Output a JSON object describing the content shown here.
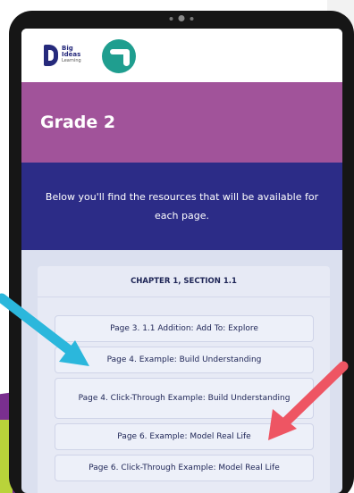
{
  "branding": {
    "logo_line1": "Big",
    "logo_line2": "Ideas",
    "logo_line3": "Learning"
  },
  "header": {
    "title": "Grade 2"
  },
  "intro": {
    "text": "Below you'll find the resources that will be available for each page."
  },
  "section": {
    "title": "CHAPTER 1, SECTION 1.1",
    "pages": [
      {
        "label": "Page 3. 1.1 Addition: Add To:  Explore"
      },
      {
        "label": "Page 4. Example:  Build Understanding"
      },
      {
        "label": "Page 4. Click-Through Example:  Build Understanding"
      },
      {
        "label": "Page 6. Example:  Model Real Life"
      },
      {
        "label": "Page 6. Click-Through Example:  Model Real Life"
      }
    ]
  },
  "colors": {
    "grade_bar": "#a1539a",
    "intro_bar": "#2c2c87",
    "arrow_blue": "#2bb7dc",
    "arrow_red": "#ee5563",
    "badge": "#1f9e8f"
  }
}
